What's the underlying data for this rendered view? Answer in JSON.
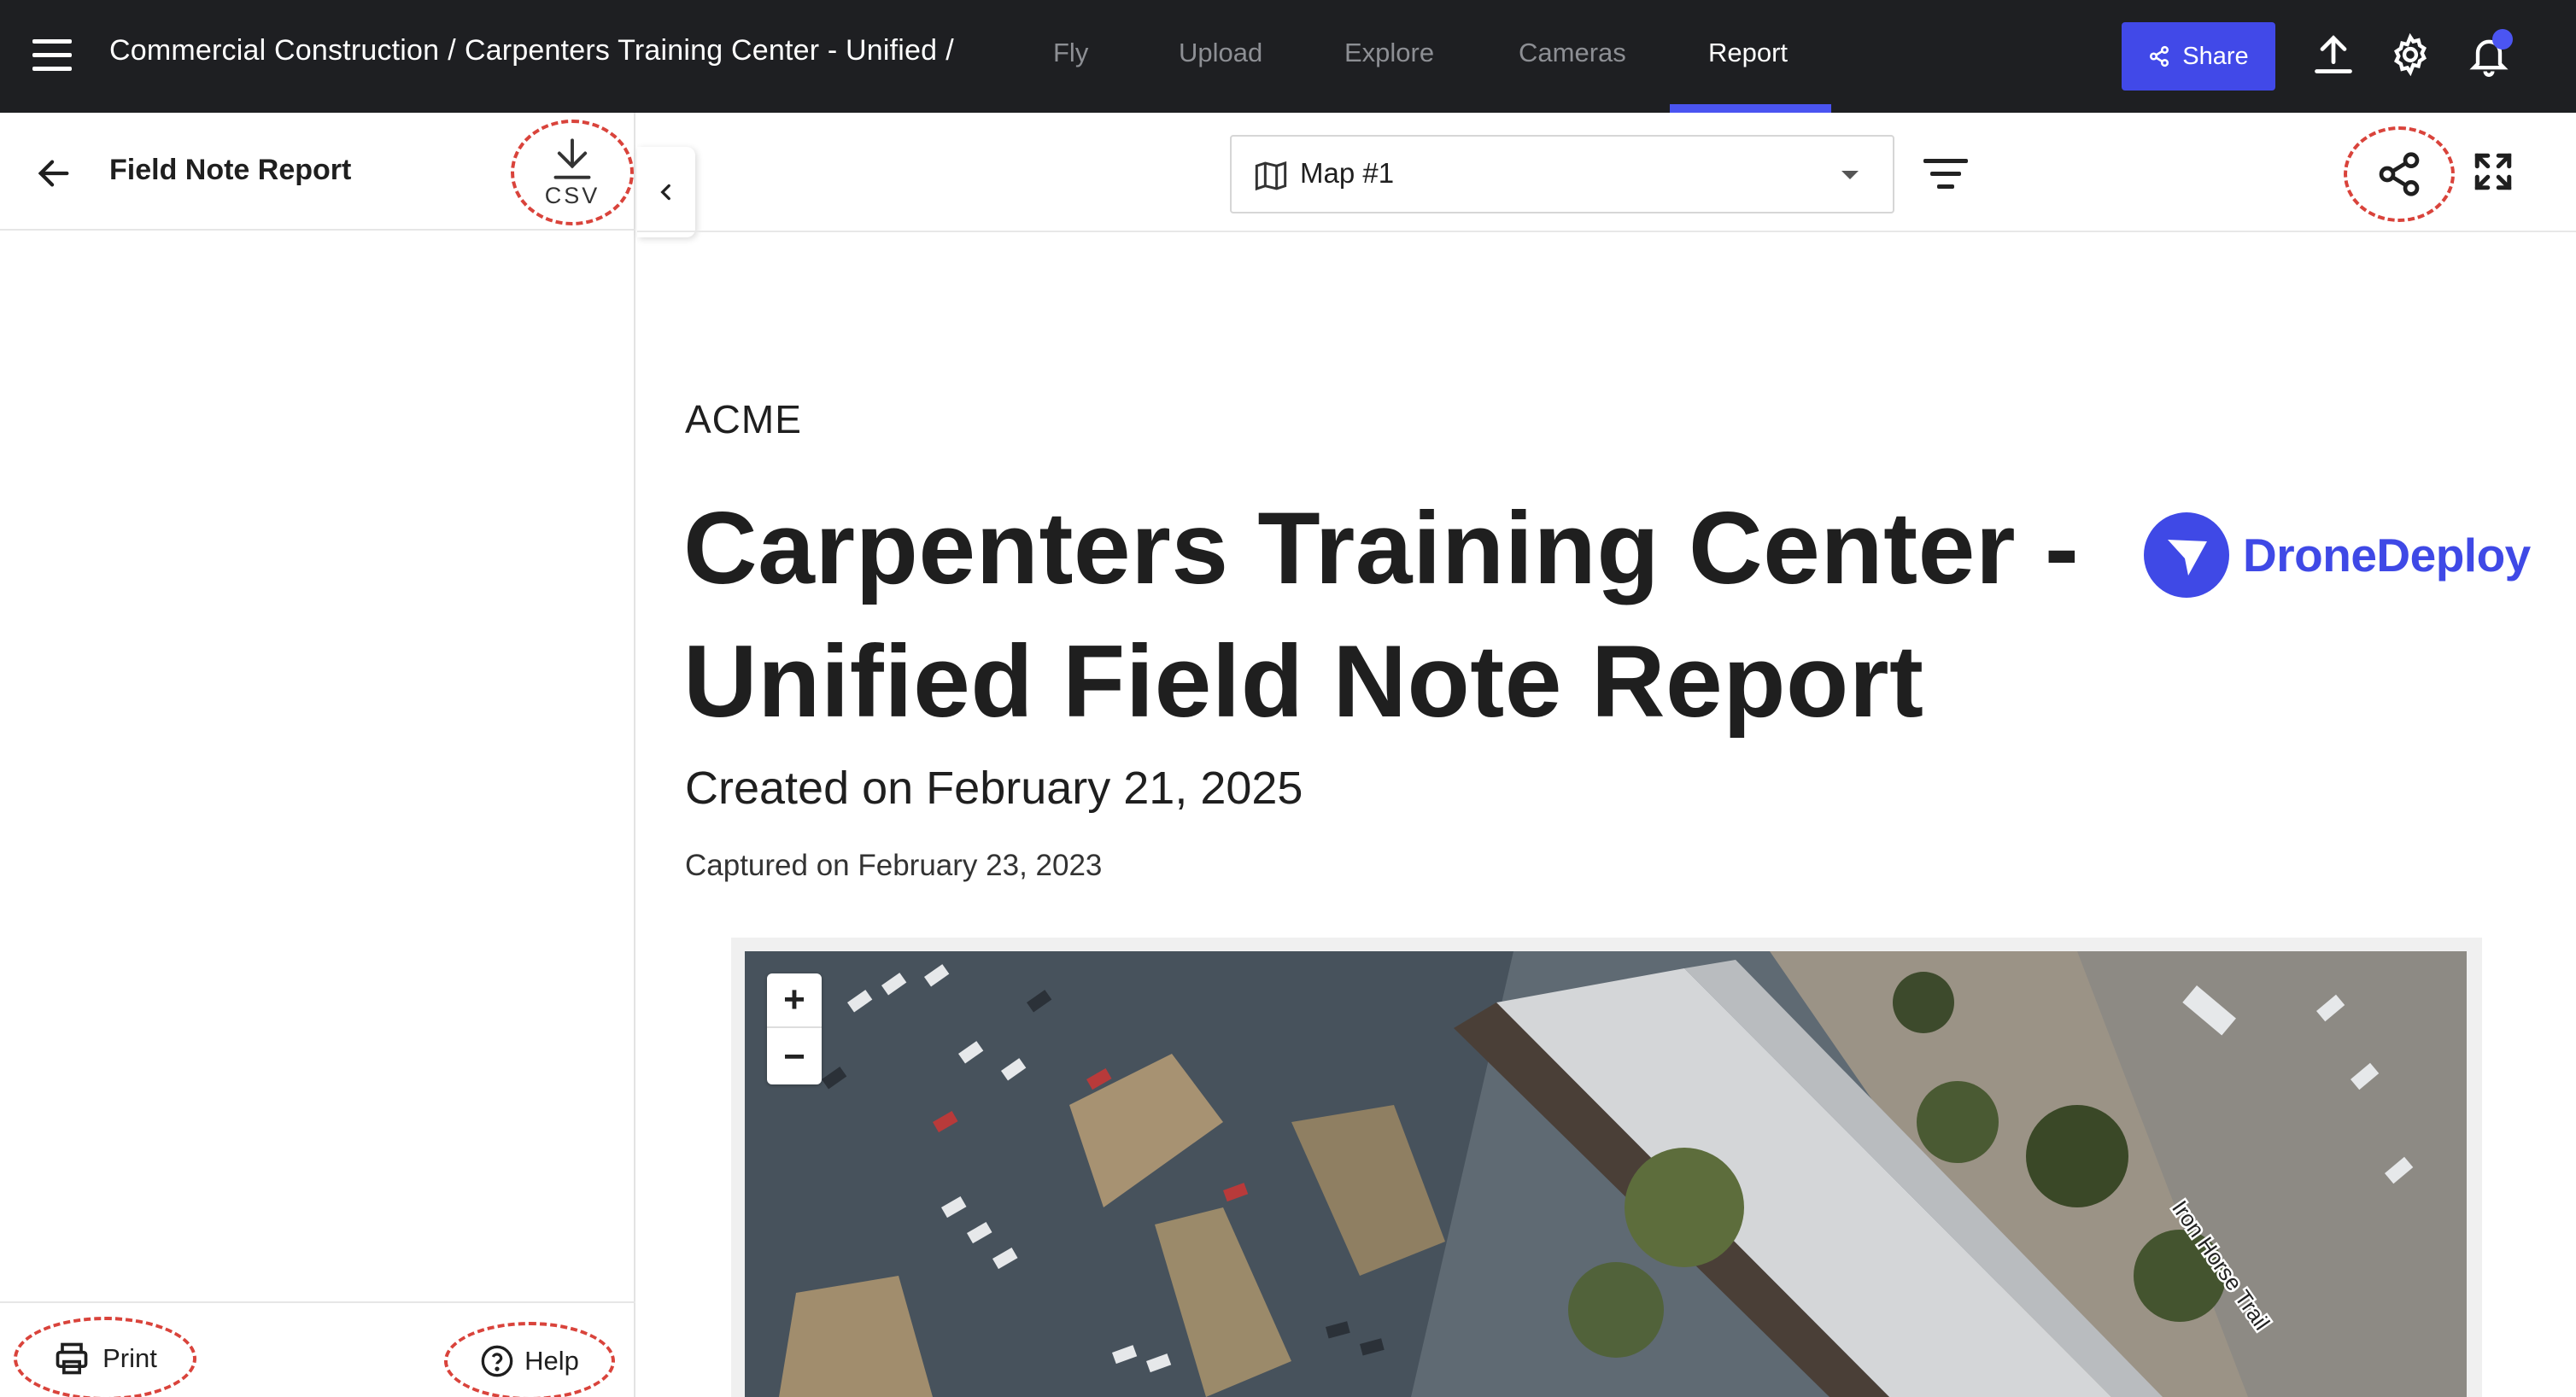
{
  "topbar": {
    "breadcrumb": [
      "Commercial Construction",
      "Carpenters Training Center - Unified"
    ],
    "separator": "/",
    "tabs": [
      {
        "label": "Fly",
        "active": false
      },
      {
        "label": "Upload",
        "active": false
      },
      {
        "label": "Explore",
        "active": false
      },
      {
        "label": "Cameras",
        "active": false
      },
      {
        "label": "Report",
        "active": true
      }
    ],
    "share_label": "Share",
    "accent_color": "#4149e8",
    "icons": [
      "menu-icon",
      "share-icon",
      "upload-icon",
      "settings-icon",
      "bell-icon"
    ]
  },
  "sidebar": {
    "title": "Field Note Report",
    "csv_label": "CSV",
    "print_label": "Print",
    "help_label": "Help",
    "icons": [
      "back-arrow-icon",
      "download-icon",
      "printer-icon",
      "help-icon",
      "chevron-left-icon"
    ]
  },
  "toolbar": {
    "map_select_value": "Map #1",
    "icons": [
      "map-icon",
      "caret-down-icon",
      "filter-icon",
      "share-icon",
      "expand-icon"
    ]
  },
  "report": {
    "organization": "ACME",
    "title": "Carpenters Training Center - Unified Field Note Report",
    "created": "Created on February 21, 2025",
    "captured": "Captured on February 23, 2023",
    "brand_name": "DroneDeploy",
    "brand_color": "#3f49e6"
  },
  "map": {
    "street_label": "Iron Horse Trail",
    "zoom_in": "+",
    "zoom_out": "−"
  },
  "highlight_color": "#d9433b"
}
